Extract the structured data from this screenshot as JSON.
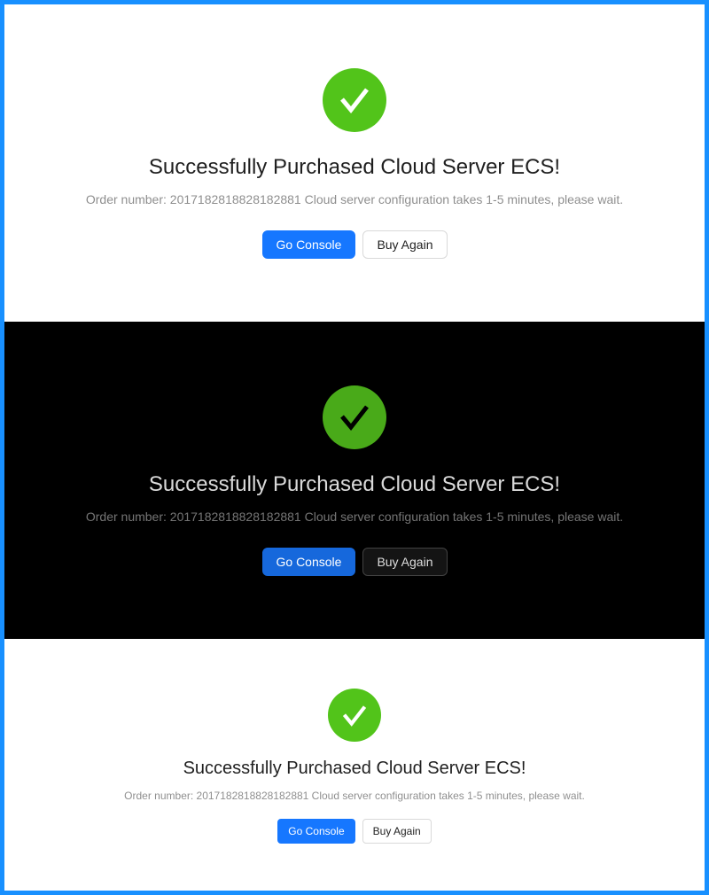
{
  "colors": {
    "frame_border": "#1890ff",
    "success_green": "#52c41a",
    "success_green_dark": "#49aa19",
    "primary_blue": "#1677ff",
    "primary_blue_dark": "#1668dc"
  },
  "result_default": {
    "icon": "check-circle-icon",
    "title": "Successfully Purchased Cloud Server ECS!",
    "subtitle": "Order number: 2017182818828182881 Cloud server configuration takes 1-5 minutes, please wait.",
    "primary_button": "Go Console",
    "secondary_button": "Buy Again"
  },
  "result_dark": {
    "icon": "check-circle-icon",
    "title": "Successfully Purchased Cloud Server ECS!",
    "subtitle": "Order number: 2017182818828182881 Cloud server configuration takes 1-5 minutes, please wait.",
    "primary_button": "Go Console",
    "secondary_button": "Buy Again"
  },
  "result_small": {
    "icon": "check-circle-icon",
    "title": "Successfully Purchased Cloud Server ECS!",
    "subtitle": "Order number: 2017182818828182881 Cloud server configuration takes 1-5 minutes, please wait.",
    "primary_button": "Go Console",
    "secondary_button": "Buy Again"
  }
}
